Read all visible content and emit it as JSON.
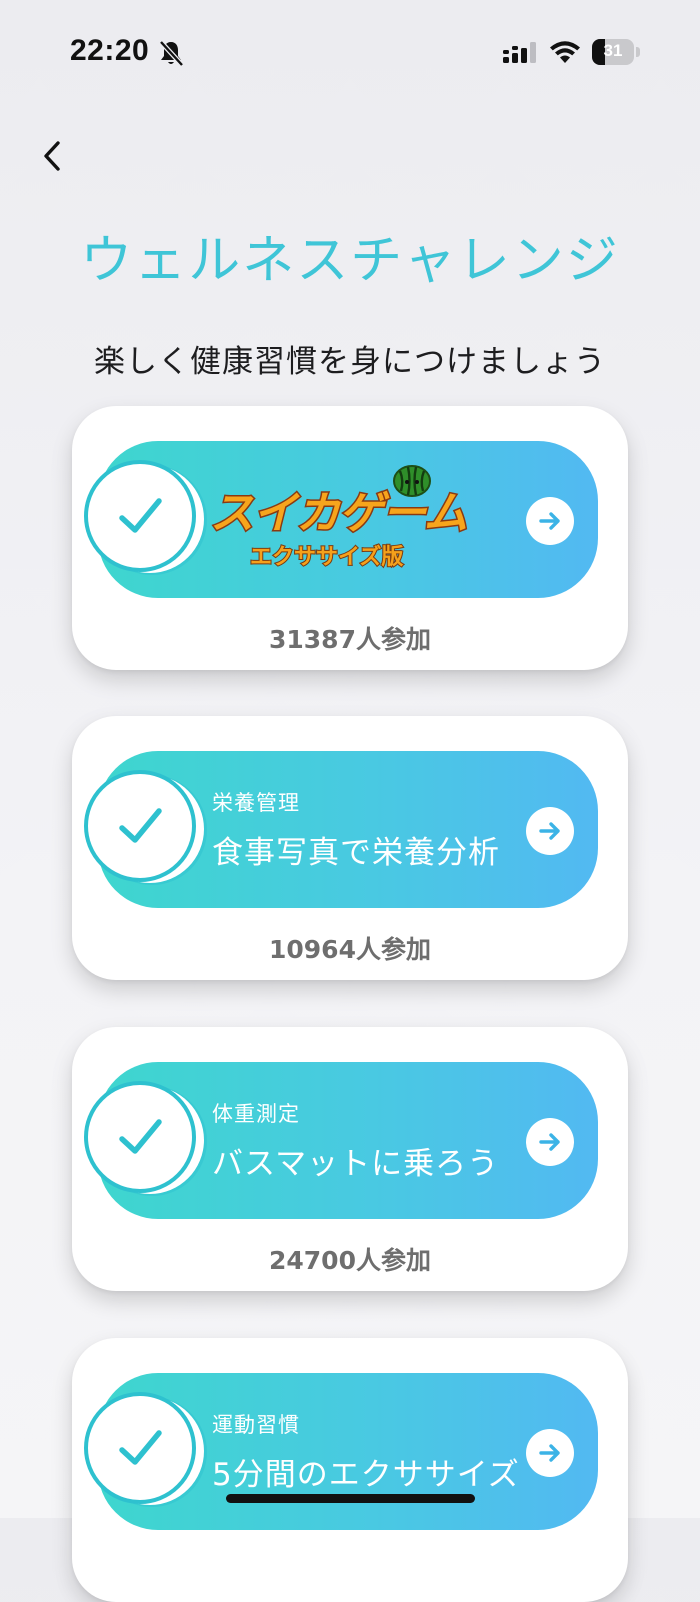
{
  "status_bar": {
    "time": "22:20",
    "battery_level": "31",
    "icons": [
      "bell-slash-icon",
      "cellular-signal-icon",
      "wifi-icon",
      "battery-icon"
    ]
  },
  "nav": {
    "back_icon": "chevron-left-icon"
  },
  "header": {
    "title": "ウェルネスチャレンジ",
    "subtitle": "楽しく健康習慣を身につけましょう"
  },
  "challenges": [
    {
      "type": "logo",
      "logo_main": "スイカゲーム",
      "logo_sub": "エクササイズ版",
      "participants": "31387人参加"
    },
    {
      "category": "栄養管理",
      "title": "食事写真で栄養分析",
      "participants": "10964人参加"
    },
    {
      "category": "体重測定",
      "title": "バスマットに乗ろう",
      "participants": "24700人参加"
    },
    {
      "category": "運動習慣",
      "title": "5分間のエクササイズ",
      "participants": ""
    }
  ],
  "colors": {
    "accent": "#3fc5d7",
    "banner_start": "#3ed6ce",
    "banner_end": "#52b9f2",
    "check": "#2ec1cf",
    "participants_text": "#6e6e6e"
  }
}
